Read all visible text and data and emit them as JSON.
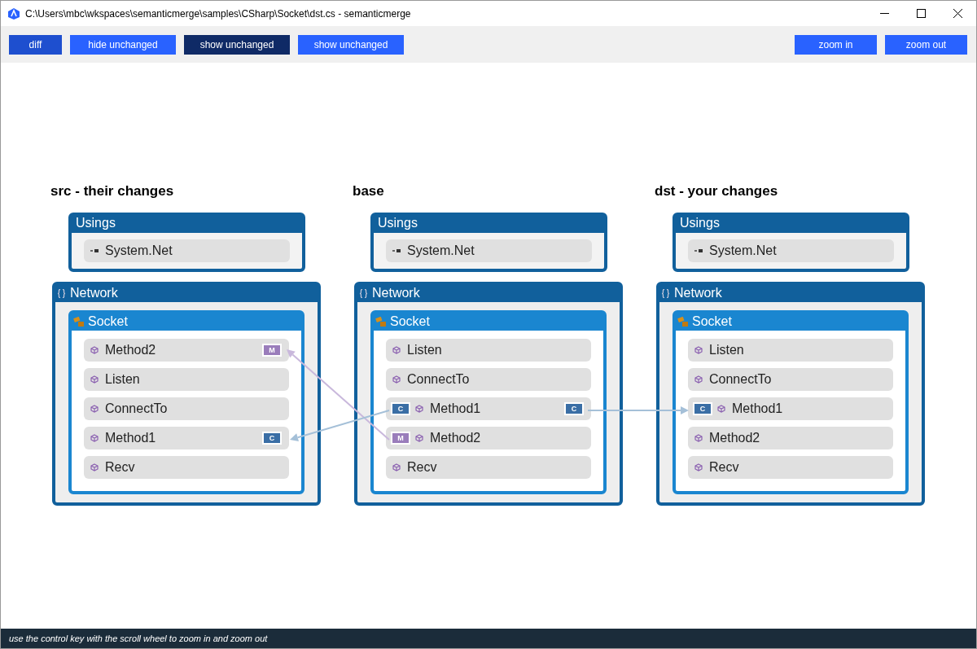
{
  "window": {
    "title": "C:\\Users\\mbc\\wkspaces\\semanticmerge\\samples\\CSharp\\Socket\\dst.cs - semanticmerge"
  },
  "toolbar": {
    "left": [
      {
        "label": "diff",
        "kind": "active"
      },
      {
        "label": "hide unchanged",
        "kind": "normal"
      },
      {
        "label": "show unchanged",
        "kind": "pressed"
      },
      {
        "label": "show unchanged",
        "kind": "normal"
      }
    ],
    "right": [
      {
        "label": "zoom in",
        "kind": "normal"
      },
      {
        "label": "zoom out",
        "kind": "normal"
      }
    ]
  },
  "columns": [
    {
      "title": "src - their changes",
      "usings": {
        "title": "Usings",
        "items": [
          {
            "label": "System.Net"
          }
        ]
      },
      "namespace": {
        "title": "Network",
        "class": {
          "title": "Socket",
          "items": [
            {
              "label": "Method2",
              "right_badge": {
                "text": "M",
                "kind": "moved"
              }
            },
            {
              "label": "Listen"
            },
            {
              "label": "ConnectTo"
            },
            {
              "label": "Method1",
              "right_badge": {
                "text": "C",
                "kind": "changed"
              }
            },
            {
              "label": "Recv"
            }
          ]
        }
      }
    },
    {
      "title": "base",
      "usings": {
        "title": "Usings",
        "items": [
          {
            "label": "System.Net"
          }
        ]
      },
      "namespace": {
        "title": "Network",
        "class": {
          "title": "Socket",
          "items": [
            {
              "label": "Listen"
            },
            {
              "label": "ConnectTo"
            },
            {
              "label": "Method1",
              "left_badge": {
                "text": "C",
                "kind": "changed"
              },
              "right_badge": {
                "text": "C",
                "kind": "changed"
              }
            },
            {
              "label": "Method2",
              "left_badge": {
                "text": "M",
                "kind": "moved"
              }
            },
            {
              "label": "Recv"
            }
          ]
        }
      }
    },
    {
      "title": "dst - your changes",
      "usings": {
        "title": "Usings",
        "items": [
          {
            "label": "System.Net"
          }
        ]
      },
      "namespace": {
        "title": "Network",
        "class": {
          "title": "Socket",
          "items": [
            {
              "label": "Listen"
            },
            {
              "label": "ConnectTo"
            },
            {
              "label": "Method1",
              "left_badge": {
                "text": "C",
                "kind": "changed"
              }
            },
            {
              "label": "Method2"
            },
            {
              "label": "Recv"
            }
          ]
        }
      }
    }
  ],
  "connectors": [
    {
      "kind": "moved"
    },
    {
      "kind": "changed"
    },
    {
      "kind": "changed"
    }
  ],
  "status_bar": {
    "text": "use the control key with the scroll wheel to zoom in and zoom out"
  }
}
